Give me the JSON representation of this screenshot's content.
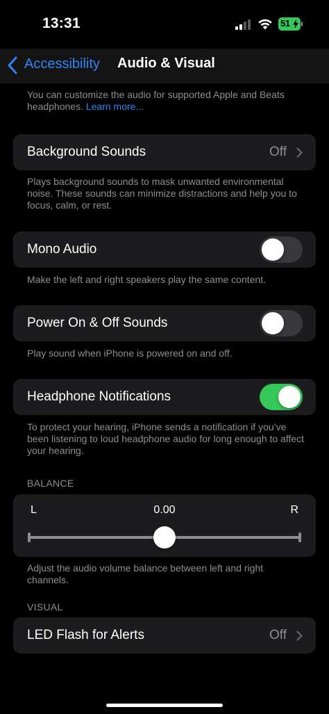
{
  "status_bar": {
    "time": "13:31",
    "battery_level": "51",
    "battery_color": "#34c759"
  },
  "nav": {
    "back_label": "Accessibility",
    "title": "Audio & Visual",
    "accent_color": "#2f86f6"
  },
  "intro": {
    "text": "You can customize the audio for supported Apple and Beats headphones.",
    "link": "Learn more..."
  },
  "background_sounds": {
    "label": "Background Sounds",
    "value": "Off",
    "footer": "Plays background sounds to mask unwanted environmental noise. These sounds can minimize distractions and help you to focus, calm, or rest."
  },
  "mono_audio": {
    "label": "Mono Audio",
    "enabled": false,
    "footer": "Make the left and right speakers play the same content."
  },
  "power_sounds": {
    "label": "Power On & Off Sounds",
    "enabled": false,
    "footer": "Play sound when iPhone is powered on and off."
  },
  "headphone_notifications": {
    "label": "Headphone Notifications",
    "enabled": true,
    "footer": "To protect your hearing, iPhone sends a notification if you’ve been listening to loud headphone audio for long enough to affect your hearing."
  },
  "balance": {
    "header": "BALANCE",
    "left_label": "L",
    "right_label": "R",
    "value": "0.00",
    "position_fraction": 0.5,
    "footer": "Adjust the audio volume balance between left and right channels."
  },
  "visual": {
    "header": "VISUAL",
    "led_flash": {
      "label": "LED Flash for Alerts",
      "value": "Off"
    }
  },
  "icons": [
    "signal-icon",
    "wifi-icon",
    "battery-icon",
    "back-chevron-icon",
    "chevron-right-icon"
  ]
}
